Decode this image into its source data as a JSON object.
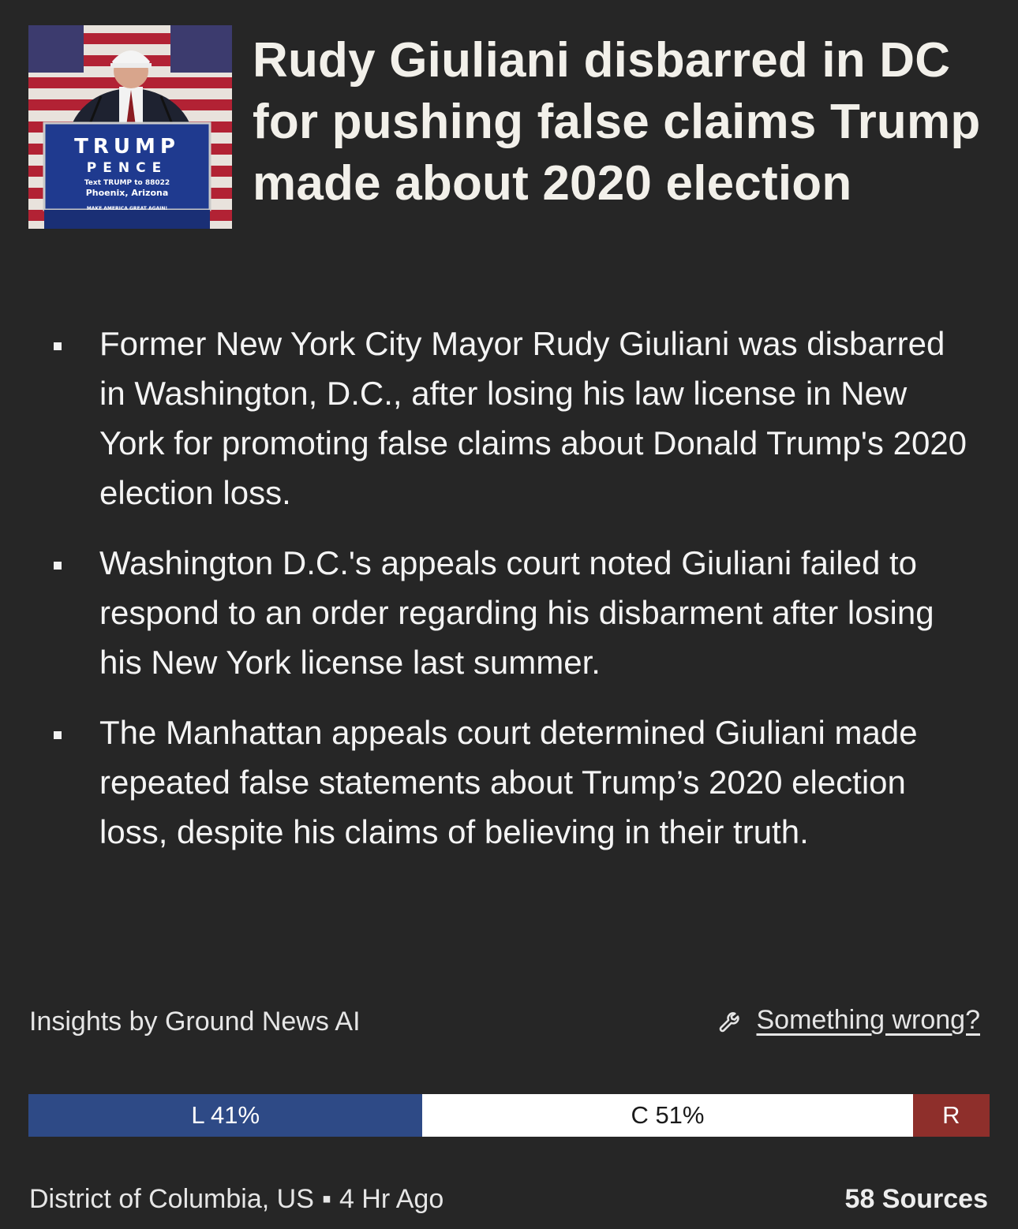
{
  "article": {
    "image_alt": "TRUMP PENCE Text TRUMP to 88022 Phoenix, Arizona MAKE AMERICA GREAT AGAIN!",
    "podium_sign": {
      "line1": "TRUMP",
      "line2": "PENCE",
      "line3": "Text TRUMP to 88022",
      "line4": "Phoenix, Arizona",
      "line5": "MAKE AMERICA GREAT AGAIN!"
    },
    "headline": "Rudy Giuliani disbarred in DC for pushing false claims Trump made about 2020 election",
    "bullets": [
      {
        "text": "Former New York City Mayor Rudy Giuliani was disbarred in Washington, D.C., after losing his law license in New York for promoting false claims about Donald Trump's 2020 election loss."
      },
      {
        "text": "Washington D.C.'s appeals court noted Giuliani failed to respond to an order regarding his disbarment after losing his New York license last summer."
      },
      {
        "text": "The Manhattan appeals court determined Giuliani made repeated false statements about Trump’s 2020 election loss, despite his claims of believing in their truth."
      }
    ]
  },
  "insights": {
    "label": "Insights by Ground News AI",
    "report_label": "Something wrong?",
    "report_icon": "wrench-icon"
  },
  "bias": {
    "left_label": "L 41%",
    "center_label": "C 51%",
    "right_label": "R",
    "left_pct": 41,
    "center_pct": 51,
    "right_pct": 8,
    "colors": {
      "left": "#2e4a86",
      "center": "#ffffff",
      "right": "#8e2f2b"
    }
  },
  "footer": {
    "location": "District of Columbia, US",
    "separator": "▪",
    "time": "4 Hr Ago",
    "sources": "58 Sources"
  }
}
